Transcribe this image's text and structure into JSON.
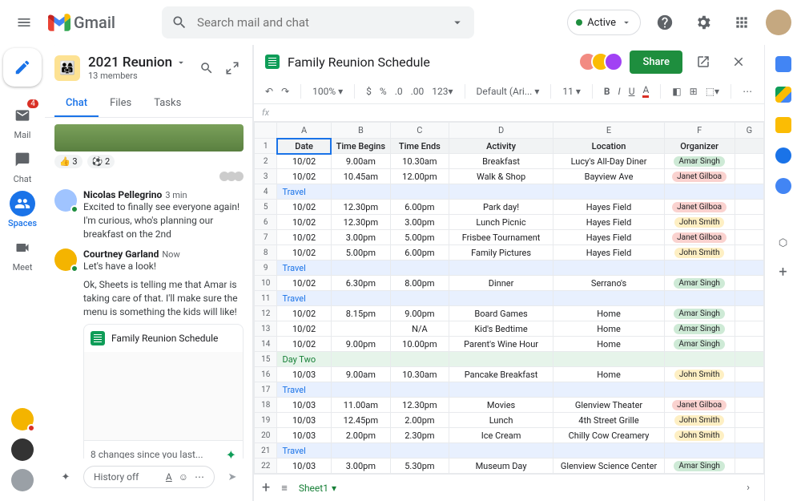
{
  "topbar": {
    "brand": "Gmail",
    "search_placeholder": "Search mail and chat",
    "active_label": "Active"
  },
  "leftnav": {
    "items": [
      {
        "label": "Mail",
        "badge": "4"
      },
      {
        "label": "Chat"
      },
      {
        "label": "Spaces"
      },
      {
        "label": "Meet"
      }
    ]
  },
  "space": {
    "title": "2021 Reunion",
    "subtitle": "13 members",
    "tabs": [
      "Chat",
      "Files",
      "Tasks"
    ],
    "reactions": [
      {
        "emoji": "👍",
        "count": "3"
      },
      {
        "emoji": "⚽",
        "count": "2"
      }
    ],
    "messages": [
      {
        "author": "Nicolas Pellegrino",
        "time": "3 min",
        "text": "Excited to finally see everyone again! I'm curious, who's planning our breakfast on the 2nd"
      },
      {
        "author": "Courtney Garland",
        "time": "Now",
        "text": "Let's have a look!",
        "text2": "Ok, Sheets is telling me that Amar is taking care of that. I'll make sure the menu is something the kids will like!"
      }
    ],
    "card_title": "Family Reunion Schedule",
    "card_footer": "8 changes since you last...",
    "composer_hint": "History off"
  },
  "sheet": {
    "title": "Family Reunion Schedule",
    "share": "Share",
    "zoom": "100%",
    "font": "Default (Ari...",
    "fontsize": "11",
    "fx": "fx",
    "tab": "Sheet1",
    "cols": [
      "",
      "A",
      "B",
      "C",
      "D",
      "E",
      "F",
      "G"
    ],
    "headers": [
      "Date",
      "Time Begins",
      "Time Ends",
      "Activity",
      "Location",
      "Organizer"
    ],
    "rows": [
      {
        "n": 2,
        "d": [
          "10/02",
          "9.00am",
          "10.30am",
          "Breakfast",
          "Lucy's All-Day Diner"
        ],
        "org": "Amar Singh",
        "oc": "amar"
      },
      {
        "n": 3,
        "d": [
          "10/02",
          "10.45am",
          "12.00pm",
          "Walk & Shop",
          "Bayview Ave"
        ],
        "org": "Janet Gilboa",
        "oc": "janet"
      },
      {
        "n": 4,
        "travel": true
      },
      {
        "n": 5,
        "d": [
          "10/02",
          "12.30pm",
          "6.00pm",
          "Park day!",
          "Hayes Field"
        ],
        "org": "Janet Gilboa",
        "oc": "janet"
      },
      {
        "n": 6,
        "d": [
          "10/02",
          "12.30pm",
          "3.00pm",
          "Lunch Picnic",
          "Hayes Field"
        ],
        "org": "John Smith",
        "oc": "john"
      },
      {
        "n": 7,
        "d": [
          "10/02",
          "3.00pm",
          "5.00pm",
          "Frisbee Tournament",
          "Hayes Field"
        ],
        "org": "Janet Gilboa",
        "oc": "janet"
      },
      {
        "n": 8,
        "d": [
          "10/02",
          "5.00pm",
          "6.00pm",
          "Family Pictures",
          "Hayes Field"
        ],
        "org": "John Smith",
        "oc": "john"
      },
      {
        "n": 9,
        "travel": true
      },
      {
        "n": 10,
        "d": [
          "10/02",
          "6.30pm",
          "8.00pm",
          "Dinner",
          "Serrano's"
        ],
        "org": "Amar Singh",
        "oc": "amar"
      },
      {
        "n": 11,
        "travel": true
      },
      {
        "n": 12,
        "d": [
          "10/02",
          "8.15pm",
          "9.00pm",
          "Board Games",
          "Home"
        ],
        "org": "Amar Singh",
        "oc": "amar"
      },
      {
        "n": 13,
        "d": [
          "10/02",
          "",
          "N/A",
          "Kid's Bedtime",
          "Home"
        ],
        "org": "Amar Singh",
        "oc": "amar"
      },
      {
        "n": 14,
        "d": [
          "10/02",
          "9.00pm",
          "10.00pm",
          "Parent's Wine Hour",
          "Home"
        ],
        "org": "Amar Singh",
        "oc": "amar"
      },
      {
        "n": 15,
        "daytwo": true,
        "label": "Day Two"
      },
      {
        "n": 16,
        "d": [
          "10/03",
          "9.00am",
          "10.30am",
          "Pancake Breakfast",
          "Home"
        ],
        "org": "John Smith",
        "oc": "john"
      },
      {
        "n": 17,
        "travel": true
      },
      {
        "n": 18,
        "d": [
          "10/03",
          "11.00am",
          "12.30pm",
          "Movies",
          "Glenview Theater"
        ],
        "org": "Janet Gilboa",
        "oc": "janet"
      },
      {
        "n": 19,
        "d": [
          "10/03",
          "12.45pm",
          "2.00pm",
          "Lunch",
          "4th Street Grille"
        ],
        "org": "John Smith",
        "oc": "john"
      },
      {
        "n": 20,
        "d": [
          "10/03",
          "2.00pm",
          "2.30pm",
          "Ice Cream",
          "Chilly Cow Creamery"
        ],
        "org": "John Smith",
        "oc": "john"
      },
      {
        "n": 21,
        "travel": true
      },
      {
        "n": 22,
        "d": [
          "10/03",
          "3.00pm",
          "5.30pm",
          "Museum Day",
          "Glenview Science Center"
        ],
        "org": "Amar Singh",
        "oc": "amar"
      }
    ],
    "travel_label": "Travel"
  }
}
